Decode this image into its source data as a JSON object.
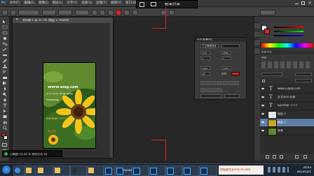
{
  "menu": {
    "items": [
      "Ps",
      "文件(F)",
      "编辑(E)",
      "图像(I)",
      "图层(L)",
      "文字(Y)",
      "选择(S)",
      "滤镜(T)",
      "视图(V)",
      "窗口(W)",
      "帮助(H)"
    ]
  },
  "remote": {
    "label": "结束分享"
  },
  "document": {
    "tab_label": "未标题-1 @ 25.7% (图层 1, RGB/8)",
    "watermark_url": "WWW.Bisg.com",
    "watermark_title": "Photoshop",
    "watermark_cn": "文字水印 处理 教程",
    "watermark_slogan": "Summer 7777",
    "watermark_note": "向日葵"
  },
  "status": {
    "text": "已缩放 33.33 % 预览方式 16"
  },
  "dialog": {
    "tab": "字符 段落样式",
    "font_family": "方正静蕾简体",
    "font_style": "-",
    "size": "72点",
    "leading": "(自动)",
    "tracking": "0",
    "kerning": "0",
    "scale_v": "100%",
    "scale_h": "100%",
    "baseline": "0点",
    "color_label": "颜色:"
  },
  "right_panel": {
    "swatch_tabs": "色板 样式",
    "adj_label": "调整",
    "layers": [
      {
        "name": "www.23psb.com",
        "kind": "text",
        "selected": false
      },
      {
        "name": "文字水印 处理",
        "kind": "text",
        "selected": false
      },
      {
        "name": "Summer 7777",
        "kind": "text",
        "selected": false
      },
      {
        "name": "图层 2",
        "kind": "image",
        "selected": false
      },
      {
        "name": "图层 1",
        "kind": "image",
        "selected": true
      },
      {
        "name": "背景",
        "kind": "image",
        "selected": false
      }
    ]
  },
  "taskbar": {
    "tasks": [
      "",
      "",
      "",
      "",
      "",
      "",
      "",
      "",
      "",
      "Adobe..",
      "",
      "",
      ""
    ],
    "ad_text": "搜狐最专业平台 zs.com",
    "time": "20:43",
    "date": "2013/12/1"
  },
  "colors": {
    "accent_red": "#e02020",
    "selection": "#5f7fa6"
  }
}
